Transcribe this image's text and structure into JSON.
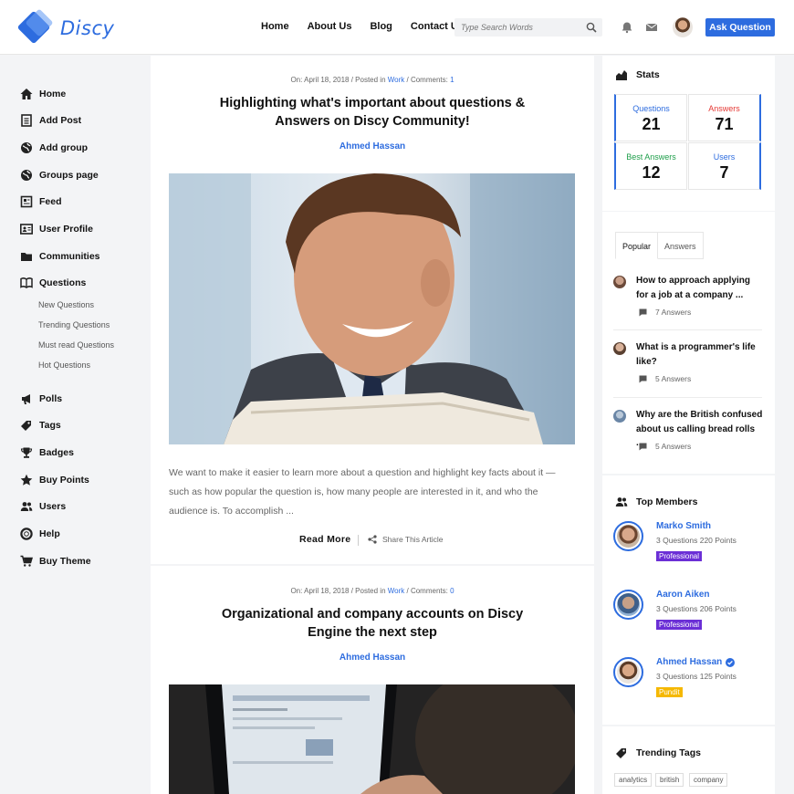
{
  "header": {
    "logo_text": "Discy",
    "nav": [
      "Home",
      "About Us",
      "Blog",
      "Contact Us"
    ],
    "search_placeholder": "Type Search Words",
    "ask_label": "Ask Question"
  },
  "sidebar": {
    "items": [
      {
        "label": "Home",
        "icon": "home-icon"
      },
      {
        "label": "Add Post",
        "icon": "document-icon"
      },
      {
        "label": "Add group",
        "icon": "globe-icon"
      },
      {
        "label": "Groups page",
        "icon": "globe-icon"
      },
      {
        "label": "Feed",
        "icon": "feed-icon"
      },
      {
        "label": "User Profile",
        "icon": "id-card-icon"
      },
      {
        "label": "Communities",
        "icon": "folder-icon"
      },
      {
        "label": "Questions",
        "icon": "book-icon"
      }
    ],
    "sub_items": [
      "New Questions",
      "Trending Questions",
      "Must read Questions",
      "Hot Questions"
    ],
    "items2": [
      {
        "label": "Polls",
        "icon": "megaphone-icon"
      },
      {
        "label": "Tags",
        "icon": "tag-icon"
      },
      {
        "label": "Badges",
        "icon": "trophy-icon"
      },
      {
        "label": "Buy Points",
        "icon": "star-icon"
      },
      {
        "label": "Users",
        "icon": "users-icon"
      },
      {
        "label": "Help",
        "icon": "lifebuoy-icon"
      },
      {
        "label": "Buy Theme",
        "icon": "cart-icon"
      }
    ]
  },
  "posts": [
    {
      "meta_prefix": "On: April 18, 2018 / Posted in ",
      "category": "Work",
      "comments_prefix": " / Comments: ",
      "comments": "1",
      "title": "Highlighting what's important about questions & Answers on Discy Community!",
      "author": "Ahmed Hassan",
      "excerpt": "We want to make it easier to learn more about a question and highlight key facts about it — such as how popular the question is, how many people are interested in it, and who the audience is. To accomplish ...",
      "read_more": "Read More",
      "share": "Share This Article"
    },
    {
      "meta_prefix": "On: April 18, 2018 / Posted in ",
      "category": "Work",
      "comments_prefix": " / Comments: ",
      "comments": "0",
      "title": "Organizational and company accounts on Discy Engine the next step",
      "author": "Ahmed Hassan"
    }
  ],
  "stats": {
    "title": "Stats",
    "items": [
      {
        "label": "Questions",
        "value": "21",
        "color": "#2d6cdf"
      },
      {
        "label": "Answers",
        "value": "71",
        "color": "#e53935"
      },
      {
        "label": "Best Answers",
        "value": "12",
        "color": "#1e9e4a"
      },
      {
        "label": "Users",
        "value": "7",
        "color": "#2d6cdf"
      }
    ]
  },
  "popular": {
    "tabs": [
      "Popular",
      "Answers"
    ],
    "questions": [
      {
        "title": "How to approach applying for a job at a company ...",
        "answers": "7 Answers"
      },
      {
        "title": "What is a programmer's life like?",
        "answers": "5 Answers"
      },
      {
        "title": "Why are the British confused about us calling bread rolls ...",
        "answers": "5 Answers"
      }
    ]
  },
  "top_members": {
    "title": "Top Members",
    "members": [
      {
        "name": "Marko Smith",
        "stats": "3 Questions   220 Points",
        "badge": "Professional",
        "badge_color": "#6b2fd6"
      },
      {
        "name": "Aaron Aiken",
        "stats": "3 Questions   206 Points",
        "badge": "Professional",
        "badge_color": "#6b2fd6"
      },
      {
        "name": "Ahmed Hassan",
        "stats": "3 Questions   125 Points",
        "badge": "Pundit",
        "badge_color": "#f5b800"
      }
    ]
  },
  "trending": {
    "title": "Trending Tags",
    "tags": [
      "analytics",
      "british",
      "company"
    ]
  }
}
